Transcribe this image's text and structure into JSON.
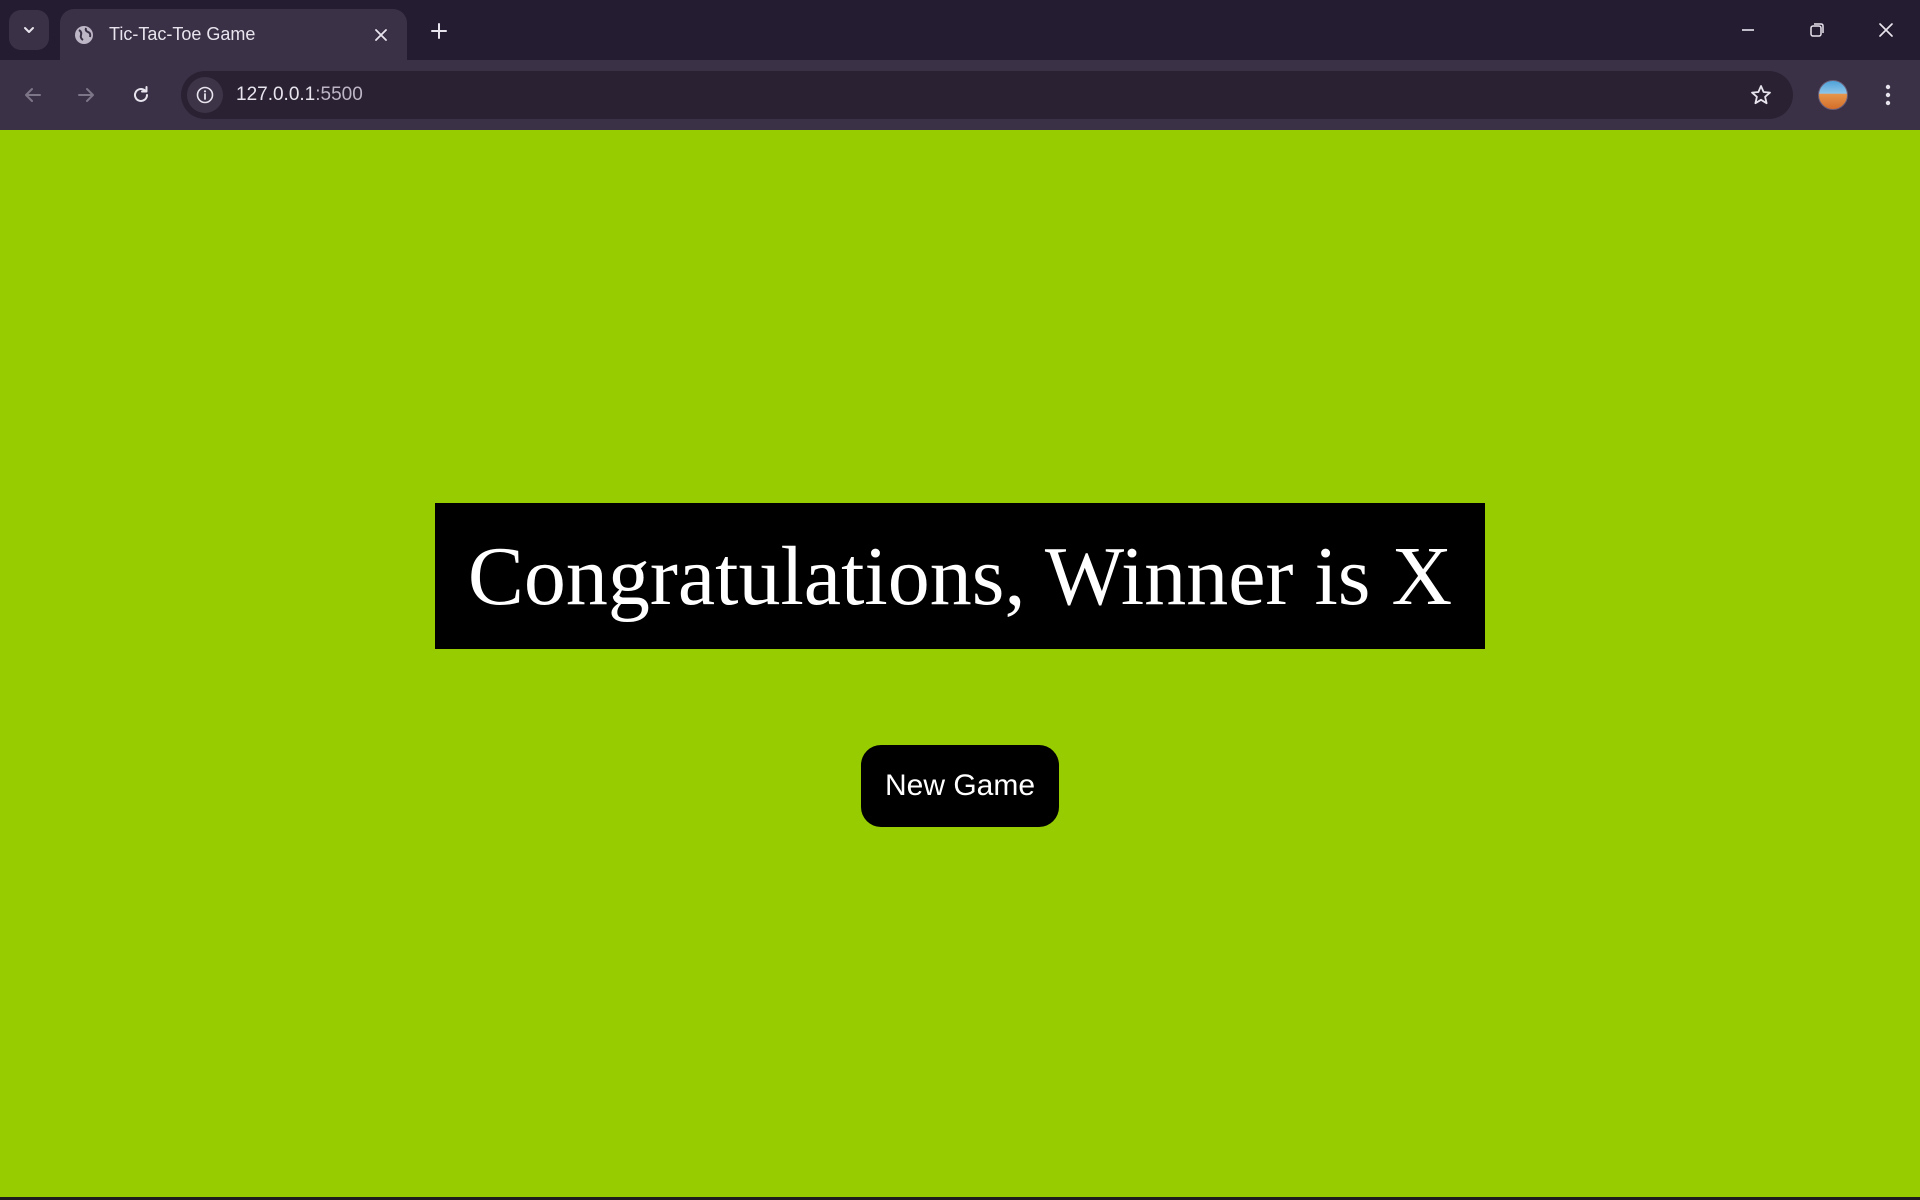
{
  "browser": {
    "tab": {
      "title": "Tic-Tac-Toe Game",
      "favicon": "globe-icon"
    },
    "address_bar": {
      "host": "127.0.0.1",
      "port": ":5500"
    },
    "icons": {
      "tab_search": "chevron-down-icon",
      "tab_close": "close-icon",
      "new_tab": "plus-icon",
      "minimize": "minimize-icon",
      "restore": "restore-icon",
      "close_window": "close-icon",
      "back": "back-arrow-icon",
      "forward": "forward-arrow-icon",
      "reload": "reload-icon",
      "site_info": "info-icon",
      "bookmark": "star-icon",
      "menu": "kebab-menu-icon"
    }
  },
  "game": {
    "message": "Congratulations, Winner is X",
    "new_game_label": "New Game"
  },
  "colors": {
    "page_background": "#97cc00",
    "message_background": "#000000",
    "message_text": "#ffffff",
    "browser_frame": "#241c30",
    "browser_toolbar": "#3a3146"
  }
}
